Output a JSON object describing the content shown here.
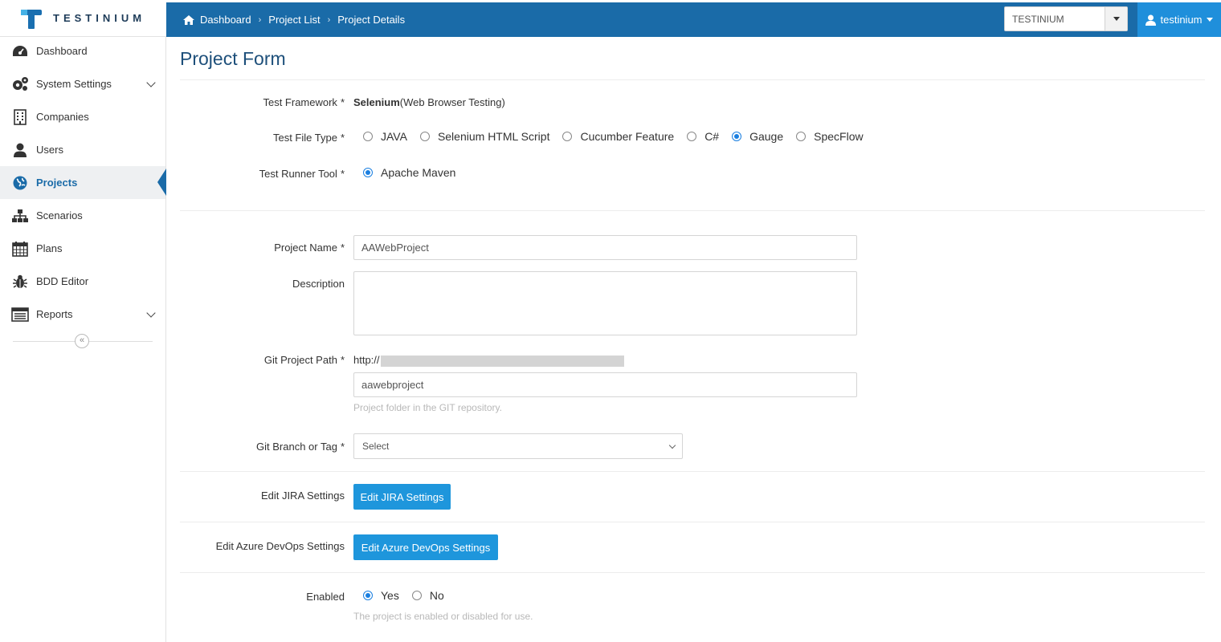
{
  "brand": {
    "name": "TESTINIUM"
  },
  "breadcrumb": [
    "Dashboard",
    "Project List",
    "Project Details"
  ],
  "org_select": {
    "value": "TESTINIUM"
  },
  "user": {
    "name": "testinium"
  },
  "sidebar": {
    "items": [
      {
        "label": "Dashboard",
        "icon": "dashboard-icon"
      },
      {
        "label": "System Settings",
        "icon": "gears-icon",
        "expandable": true
      },
      {
        "label": "Companies",
        "icon": "building-icon"
      },
      {
        "label": "Users",
        "icon": "user-icon"
      },
      {
        "label": "Projects",
        "icon": "globe-icon",
        "active": true
      },
      {
        "label": "Scenarios",
        "icon": "sitemap-icon"
      },
      {
        "label": "Plans",
        "icon": "calendar-icon"
      },
      {
        "label": "BDD Editor",
        "icon": "bug-icon"
      },
      {
        "label": "Reports",
        "icon": "report-icon",
        "expandable": true
      }
    ],
    "collapse_label": "«"
  },
  "form": {
    "title": "Project Form",
    "test_framework": {
      "label": "Test Framework",
      "value_bold": "Selenium",
      "value_rest": "(Web Browser Testing)"
    },
    "test_file_type": {
      "label": "Test File Type",
      "options": [
        "JAVA",
        "Selenium HTML Script",
        "Cucumber Feature",
        "C#",
        "Gauge",
        "SpecFlow"
      ],
      "selected": "Gauge"
    },
    "test_runner_tool": {
      "label": "Test Runner Tool",
      "options": [
        "Apache Maven"
      ],
      "selected": "Apache Maven"
    },
    "project_name": {
      "label": "Project Name",
      "value": "AAWebProject"
    },
    "description": {
      "label": "Description",
      "value": ""
    },
    "git_project_path": {
      "label": "Git Project Path",
      "prefix": "http://",
      "folder": "aawebproject",
      "help": "Project folder in the GIT repository."
    },
    "git_branch": {
      "label": "Git Branch or Tag",
      "value": "Select"
    },
    "jira": {
      "label": "Edit JIRA Settings",
      "button": "Edit JIRA Settings"
    },
    "azure": {
      "label": "Edit Azure DevOps Settings",
      "button": "Edit Azure DevOps Settings"
    },
    "enabled": {
      "label": "Enabled",
      "options": [
        "Yes",
        "No"
      ],
      "selected": "Yes",
      "help": "The project is enabled or disabled for use."
    },
    "required_mark": "*"
  },
  "colors": {
    "navbar": "#1a6ba8",
    "accent": "#1e96dc",
    "user_menu": "#1f8fdb"
  }
}
